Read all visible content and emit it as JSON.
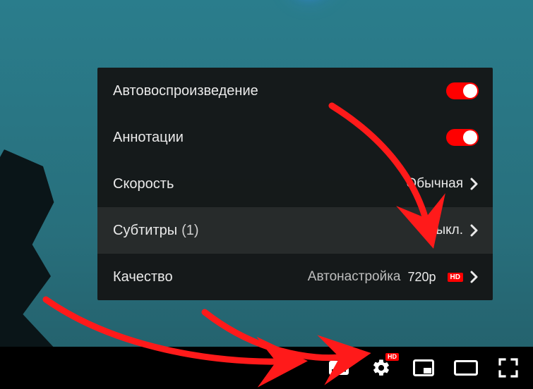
{
  "settings": {
    "rows": {
      "autoplay": {
        "label": "Автовоспроизведение",
        "toggle": true
      },
      "annotations": {
        "label": "Аннотации",
        "toggle": true
      },
      "speed": {
        "label": "Скорость",
        "value": "Обычная"
      },
      "subtitles": {
        "label": "Субтитры",
        "count": "(1)",
        "value": "Выкл."
      },
      "quality": {
        "label": "Качество",
        "value": "Автонастройка",
        "detail": "720p",
        "hd": "HD"
      }
    }
  },
  "player_bar": {
    "captions_icon": "subtitles",
    "settings_icon": "gear",
    "settings_hd": "HD",
    "miniplayer_icon": "miniplayer",
    "theater_icon": "theater",
    "fullscreen_icon": "fullscreen"
  },
  "colors": {
    "accent": "#ff0000",
    "panel_bg": "rgba(20,20,20,0.94)",
    "video_bg": "#2a7d8c"
  },
  "video_content": {
    "description": "lightsaber over teal background with silhouette"
  }
}
